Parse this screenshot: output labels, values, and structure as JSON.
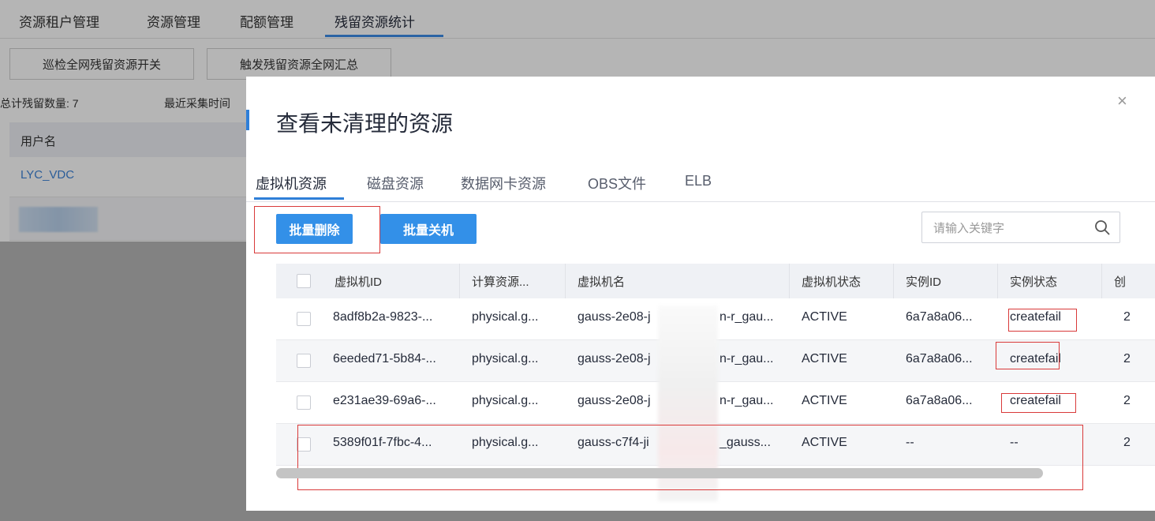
{
  "background": {
    "tabs": [
      "资源租户管理",
      "资源管理",
      "配额管理",
      "残留资源统计"
    ],
    "active_tab": "残留资源统计",
    "buttons": {
      "inspect_switch": "巡检全网残留资源开关",
      "trigger_summary": "触发残留资源全网汇总"
    },
    "stats": {
      "total_label": "总计残留数量: 7",
      "collect_time_label": "最近采集时间"
    },
    "table": {
      "header": "用户名",
      "rows": [
        "LYC_VDC"
      ]
    }
  },
  "modal": {
    "title": "查看未清理的资源",
    "close": "×",
    "tabs": [
      "虚拟机资源",
      "磁盘资源",
      "数据网卡资源",
      "OBS文件",
      "ELB"
    ],
    "active_tab": "虚拟机资源",
    "buttons": {
      "batch_delete": "批量删除",
      "batch_shutdown": "批量关机"
    },
    "search": {
      "placeholder": "请输入关键字",
      "value": ""
    },
    "table": {
      "columns": [
        "虚拟机ID",
        "计算资源...",
        "虚拟机名",
        "虚拟机状态",
        "实例ID",
        "实例状态",
        "创"
      ],
      "rows": [
        {
          "vm_id": "8adf8b2a-9823-...",
          "compute": "physical.g...",
          "vm_name": "gauss-2e08-j",
          "vm_name_tail": "n-r_gau...",
          "vm_state": "ACTIVE",
          "instance_id": "6a7a8a06...",
          "instance_state": "createfail",
          "extra": "2"
        },
        {
          "vm_id": "6eeded71-5b84-...",
          "compute": "physical.g...",
          "vm_name": "gauss-2e08-j",
          "vm_name_tail": "n-r_gau...",
          "vm_state": "ACTIVE",
          "instance_id": "6a7a8a06...",
          "instance_state": "createfail",
          "extra": "2"
        },
        {
          "vm_id": "e231ae39-69a6-...",
          "compute": "physical.g...",
          "vm_name": "gauss-2e08-j",
          "vm_name_tail": "n-r_gau...",
          "vm_state": "ACTIVE",
          "instance_id": "6a7a8a06...",
          "instance_state": "createfail",
          "extra": "2"
        },
        {
          "vm_id": "5389f01f-7fbc-4...",
          "compute": "physical.g...",
          "vm_name": "gauss-c7f4-ji",
          "vm_name_tail": "_gauss...",
          "vm_state": "ACTIVE",
          "instance_id": "--",
          "instance_state": "--",
          "extra": "2"
        }
      ]
    }
  },
  "colors": {
    "primary": "#3390e8",
    "accent": "#2f7fd8",
    "link": "#3d84d8",
    "highlight_box": "#d93a3a"
  },
  "icons": {
    "search": "search-icon",
    "close": "close-icon"
  }
}
